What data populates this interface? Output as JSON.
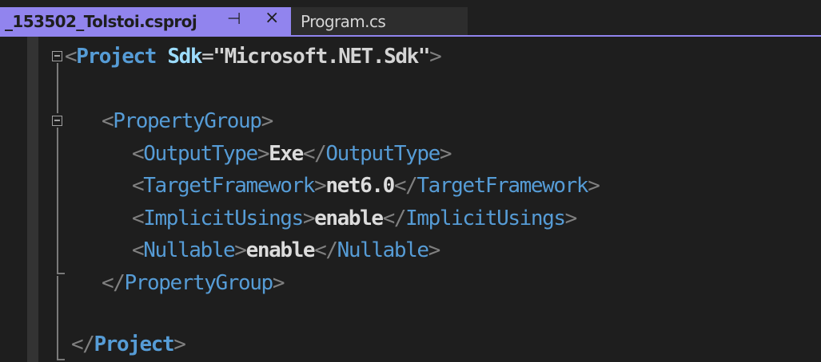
{
  "tabs": {
    "active_label": "_153502_Tolstoi.csproj",
    "pin_glyph": "⊣",
    "close_glyph": "×",
    "inactive_label": "Program.cs"
  },
  "code": {
    "line1": {
      "open": "<",
      "tag": "Project",
      "attr": "Sdk",
      "eq": "=",
      "value": "\"Microsoft.NET.Sdk\"",
      "close": ">"
    },
    "line3": {
      "open": "<",
      "tag": "PropertyGroup",
      "close": ">"
    },
    "line4": {
      "open": "<",
      "tag": "OutputType",
      "mid1": ">",
      "text": "Exe",
      "mid2": "</",
      "tag2": "OutputType",
      "close": ">"
    },
    "line5": {
      "open": "<",
      "tag": "TargetFramework",
      "mid1": ">",
      "text": "net6.0",
      "mid2": "</",
      "tag2": "TargetFramework",
      "close": ">"
    },
    "line6": {
      "open": "<",
      "tag": "ImplicitUsings",
      "mid1": ">",
      "text": "enable",
      "mid2": "</",
      "tag2": "ImplicitUsings",
      "close": ">"
    },
    "line7": {
      "open": "<",
      "tag": "Nullable",
      "mid1": ">",
      "text": "enable",
      "mid2": "</",
      "tag2": "Nullable",
      "close": ">"
    },
    "line8": {
      "open": "</",
      "tag": "PropertyGroup",
      "close": ">"
    },
    "line10": {
      "open": "</",
      "tag": "Project",
      "close": ">"
    }
  },
  "colors": {
    "tab_accent": "#9184ee",
    "editor_bg": "#1e1e1e",
    "tag": "#569cd6",
    "attribute": "#9cdcfe",
    "bracket": "#808080"
  }
}
